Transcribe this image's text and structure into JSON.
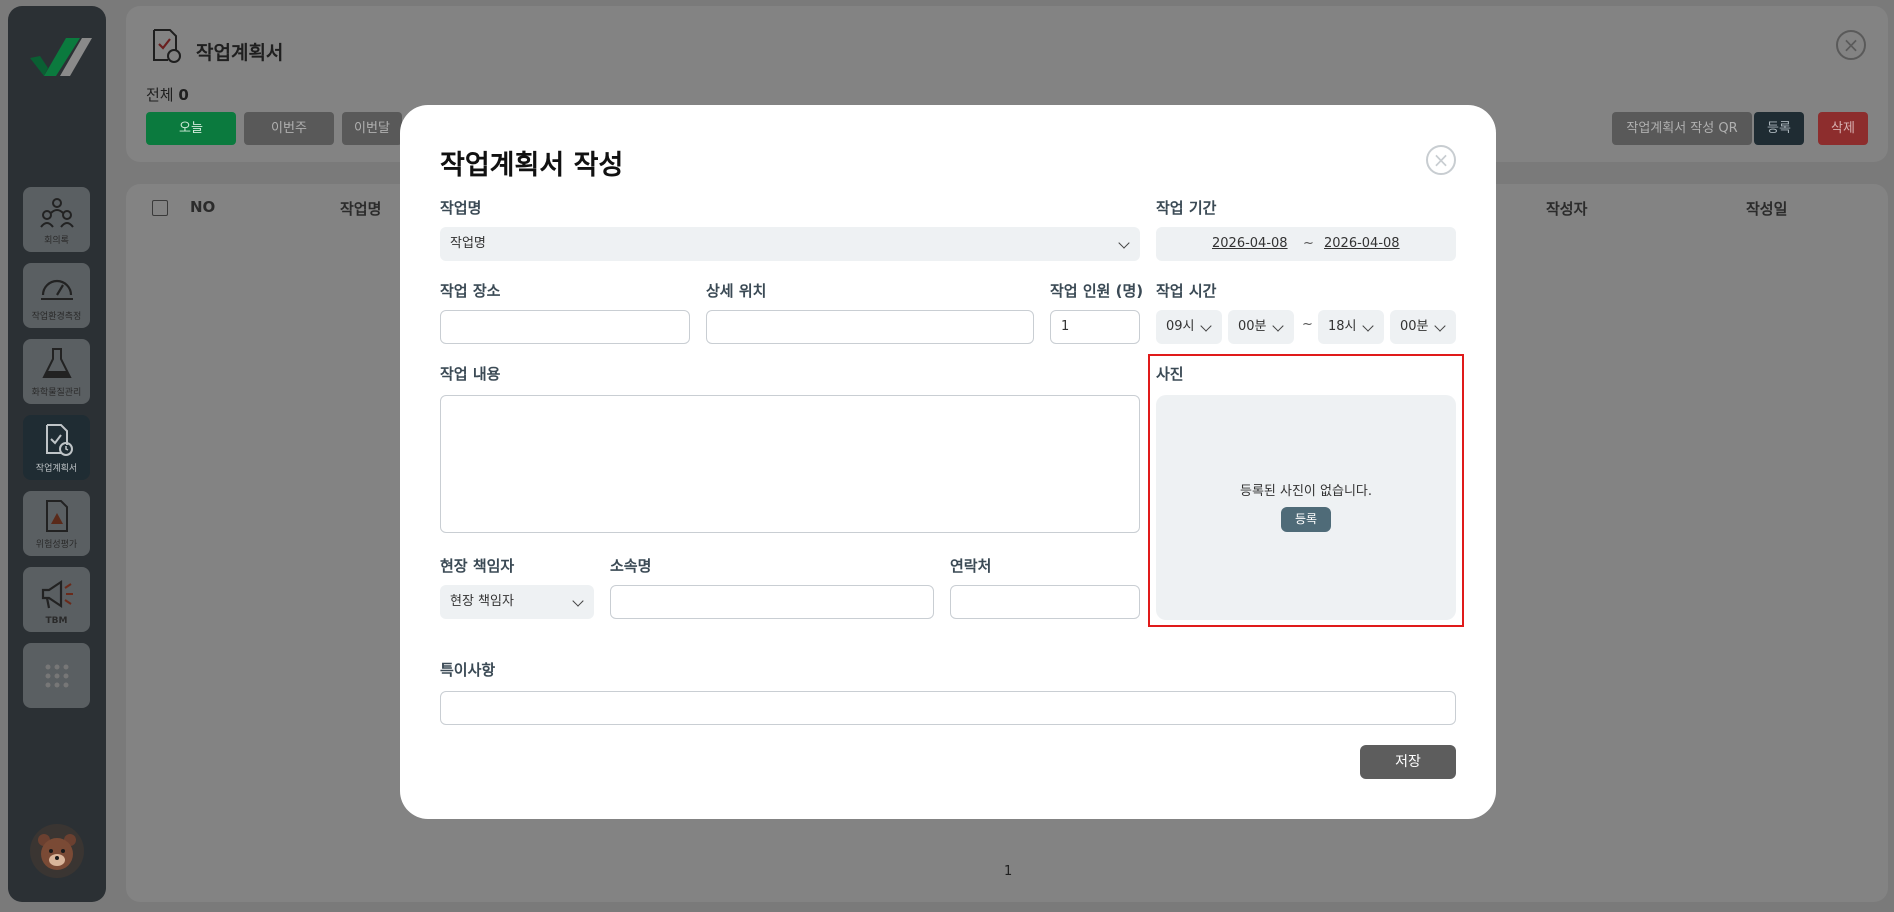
{
  "sidebar": {
    "items": [
      {
        "label": "회의록",
        "icon": "meeting-icon"
      },
      {
        "label": "작업환경측정",
        "icon": "gauge-icon"
      },
      {
        "label": "화학물질관리",
        "icon": "flask-icon"
      },
      {
        "label": "작업계획서",
        "icon": "work-plan-icon",
        "active": true
      },
      {
        "label": "위험성평가",
        "icon": "warning-doc-icon"
      },
      {
        "label": "TBM",
        "icon": "megaphone-icon"
      }
    ],
    "more_icon": "grid-dots-icon"
  },
  "page": {
    "title": "작업계획서",
    "total_label": "전체",
    "total_count": "0",
    "filters": {
      "today": "오늘",
      "this_week": "이번주",
      "this_month": "이번달"
    },
    "actions": {
      "qr": "작업계획서 작성 QR",
      "register": "등록",
      "delete": "삭제"
    },
    "table_headers": {
      "no": "NO",
      "work_name": "작업명",
      "author": "작성자",
      "created": "작성일"
    },
    "pagination": "1"
  },
  "modal": {
    "title": "작업계획서 작성",
    "work_name": {
      "label": "작업명",
      "value": "작업명"
    },
    "period": {
      "label": "작업 기간",
      "start": "2026-04-08",
      "separator": "~",
      "end": "2026-04-08"
    },
    "location": {
      "label": "작업 장소",
      "value": ""
    },
    "detail_location": {
      "label": "상세 위치",
      "value": ""
    },
    "headcount": {
      "label": "작업 인원 (명)",
      "value": "1"
    },
    "time": {
      "label": "작업 시간",
      "start_hour": "09시",
      "start_min": "00분",
      "separator": "~",
      "end_hour": "18시",
      "end_min": "00분"
    },
    "content": {
      "label": "작업 내용",
      "value": ""
    },
    "photo": {
      "label": "사진",
      "empty_text": "등록된 사진이 없습니다.",
      "register_label": "등록"
    },
    "site_manager": {
      "label": "현장 책임자",
      "value": "현장 책임자"
    },
    "affiliation": {
      "label": "소속명",
      "value": ""
    },
    "contact": {
      "label": "연락처",
      "value": ""
    },
    "remarks": {
      "label": "특이사항",
      "value": ""
    },
    "save_label": "저장"
  },
  "colors": {
    "accent_green": "#0b7a3e",
    "highlight": "#e01a1a",
    "photo_button": "#4f6b78",
    "save_button": "#5d5d5d"
  }
}
